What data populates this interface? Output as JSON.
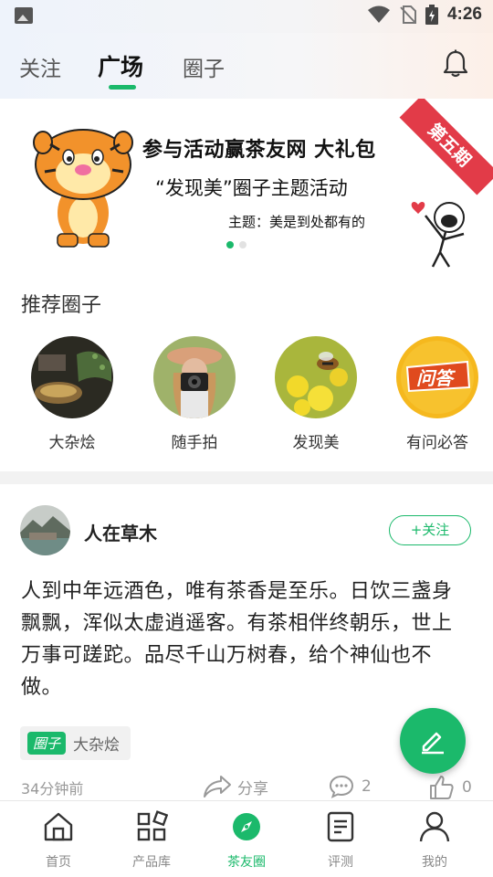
{
  "status_bar": {
    "time": "4:26"
  },
  "top_tabs": [
    {
      "label": "关注",
      "active": false
    },
    {
      "label": "广场",
      "active": true
    },
    {
      "label": "圈子",
      "active": false
    }
  ],
  "banner": {
    "title": "参与活动赢茶友网  大礼包",
    "subtitle": "“发现美”圈子主题活动",
    "theme": "主题：美是到处都有的",
    "ribbon": "第五期",
    "page_indicator": {
      "current": 1,
      "total": 2
    }
  },
  "recommended": {
    "title": "推荐圈子",
    "items": [
      {
        "label": "大杂烩",
        "icon": "tea-scene"
      },
      {
        "label": "随手拍",
        "icon": "camera-person"
      },
      {
        "label": "发现美",
        "icon": "bee-flower"
      },
      {
        "label": "有问必答",
        "icon": "qa-badge",
        "badge_text": "问答"
      }
    ]
  },
  "post": {
    "username": "人在草木",
    "follow_label": "+关注",
    "body": "人到中年远酒色，唯有茶香是至乐。日饮三盏身飘飘，浑似太虚逍遥客。有茶相伴终朝乐，世上万事可蹉跎。品尽千山万树春，给个神仙也不做。",
    "tag_type": "圈子",
    "tag_name": "大杂烩",
    "timestamp": "34分钟前",
    "share_label": "分享",
    "comment_count": "2",
    "like_count": "0"
  },
  "bottom_nav": [
    {
      "label": "首页",
      "icon": "home-icon",
      "active": false
    },
    {
      "label": "产品库",
      "icon": "grid-icon",
      "active": false
    },
    {
      "label": "茶友圈",
      "icon": "compass-icon",
      "active": true
    },
    {
      "label": "评测",
      "icon": "list-icon",
      "active": false
    },
    {
      "label": "我的",
      "icon": "user-icon",
      "active": false
    }
  ],
  "colors": {
    "accent": "#1bb96b",
    "ribbon": "#e23b48"
  }
}
